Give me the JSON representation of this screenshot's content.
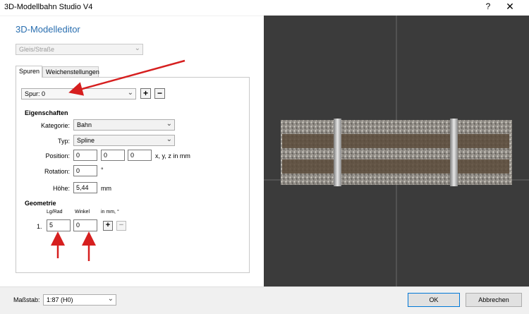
{
  "window": {
    "title": "3D-Modellbahn Studio V4",
    "help_glyph": "?",
    "close_glyph": "✕"
  },
  "editor": {
    "heading": "3D-Modelleditor",
    "type_select": "Gleis/Straße",
    "tabs": [
      "Spuren",
      "Weichenstellungen"
    ],
    "track_select": "Spur: 0",
    "add_glyph": "+",
    "remove_glyph": "−"
  },
  "properties": {
    "heading": "Eigenschaften",
    "category_label": "Kategorie:",
    "category_value": "Bahn",
    "typ_label": "Typ:",
    "typ_value": "Spline",
    "position_label": "Position:",
    "position_values": [
      "0",
      "0",
      "0"
    ],
    "position_unit": "x, y, z in mm",
    "rotation_label": "Rotation:",
    "rotation_value": "0",
    "rotation_unit": "°",
    "height_label": "Höhe:",
    "height_value": "5,44",
    "height_unit": "mm"
  },
  "geometry": {
    "heading": "Geometrie",
    "col_length": "Lg/Rad",
    "col_angle": "Winkel",
    "col_units": "in mm, °",
    "rows": [
      {
        "index": "1.",
        "length": "5",
        "angle": "0"
      }
    ]
  },
  "footer": {
    "scale_label": "Maßstab:",
    "scale_value": "1:87 (H0)",
    "ok_label": "OK",
    "cancel_label": "Abbrechen"
  },
  "colors": {
    "heading_blue": "#2a6fb0",
    "viewport_bg": "#3b3b3b",
    "annotation_arrow": "#d61f1f"
  },
  "icons": [
    "chevron-down-icon",
    "plus-icon",
    "minus-icon",
    "close-icon",
    "help-icon"
  ]
}
